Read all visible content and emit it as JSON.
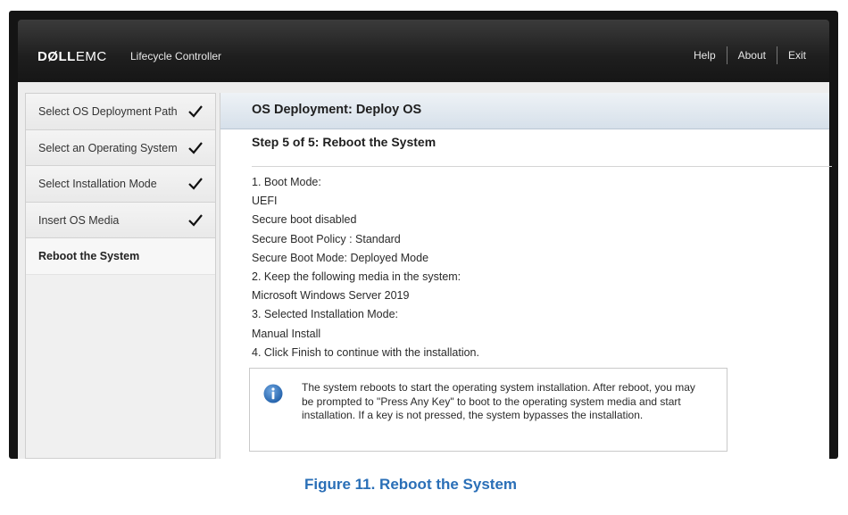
{
  "header": {
    "logo_dell": "DØLL",
    "logo_emc": "EMC",
    "app_name": "Lifecycle Controller",
    "nav": [
      "Help",
      "About",
      "Exit"
    ]
  },
  "sidebar": {
    "items": [
      {
        "label": "Select OS Deployment Path",
        "done": true
      },
      {
        "label": "Select an Operating System",
        "done": true
      },
      {
        "label": "Select Installation Mode",
        "done": true
      },
      {
        "label": "Insert OS Media",
        "done": true
      },
      {
        "label": "Reboot the System",
        "done": false,
        "active": true
      }
    ]
  },
  "main": {
    "header": "OS Deployment: Deploy OS",
    "step_title": "Step 5 of 5: Reboot the System",
    "lines": [
      "1. Boot Mode:",
      "UEFI",
      "Secure boot disabled",
      "Secure Boot Policy : Standard",
      "Secure Boot Mode: Deployed Mode",
      "2. Keep the following media in the system:",
      "Microsoft Windows Server 2019",
      "3. Selected Installation Mode:",
      "Manual Install",
      "4. Click Finish to continue with the installation."
    ],
    "info": "The system reboots to start the operating system installation. After reboot, you may be prompted to \"Press Any Key\" to boot to the operating system media and start installation. If a key is not pressed, the system bypasses the installation."
  },
  "caption": "Figure 11. Reboot the System",
  "colors": {
    "caption": "#2a6fb7",
    "topbar": "#1e1e1e",
    "info_icon": "#2f6fb5"
  }
}
